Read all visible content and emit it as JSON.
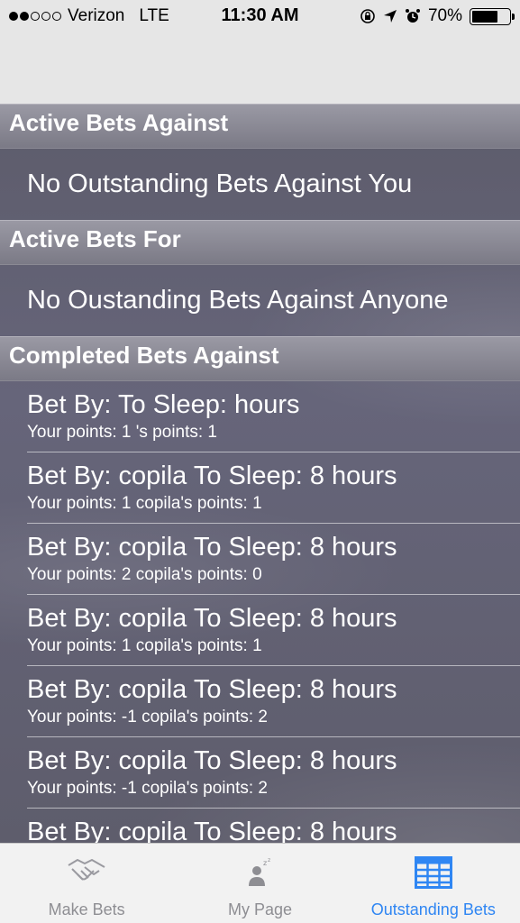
{
  "status_bar": {
    "carrier": "Verizon",
    "network": "LTE",
    "time": "11:30 AM",
    "battery": "70%",
    "battery_level": 0.7
  },
  "sections": {
    "active_against": {
      "header": "Active Bets Against",
      "empty_text": "No Outstanding Bets Against You"
    },
    "active_for": {
      "header": "Active Bets For",
      "empty_text": "No Oustanding Bets Against Anyone"
    },
    "completed_against": {
      "header": "Completed Bets Against",
      "rows": [
        {
          "title": "Bet By:  To Sleep:  hours",
          "points": "Your points: 1  's points: 1"
        },
        {
          "title": "Bet By: copila To Sleep: 8 hours",
          "points": "Your points: 1  copila's points: 1"
        },
        {
          "title": "Bet By: copila To Sleep: 8 hours",
          "points": "Your points: 2  copila's points: 0"
        },
        {
          "title": "Bet By: copila To Sleep: 8 hours",
          "points": "Your points: 1  copila's points: 1"
        },
        {
          "title": "Bet By: copila To Sleep: 8 hours",
          "points": "Your points: -1  copila's points: 2"
        },
        {
          "title": "Bet By: copila To Sleep: 8 hours",
          "points": "Your points: -1  copila's points: 2"
        },
        {
          "title": "Bet By: copila To Sleep: 8 hours",
          "points": ""
        }
      ]
    }
  },
  "tab_bar": {
    "tabs": [
      {
        "label": "Make Bets",
        "icon": "handshake-icon"
      },
      {
        "label": "My Page",
        "icon": "person-sleeping-icon"
      },
      {
        "label": "Outstanding Bets",
        "icon": "table-icon"
      }
    ],
    "active_color": "#2f86f3",
    "inactive_color": "#8e8e93"
  }
}
